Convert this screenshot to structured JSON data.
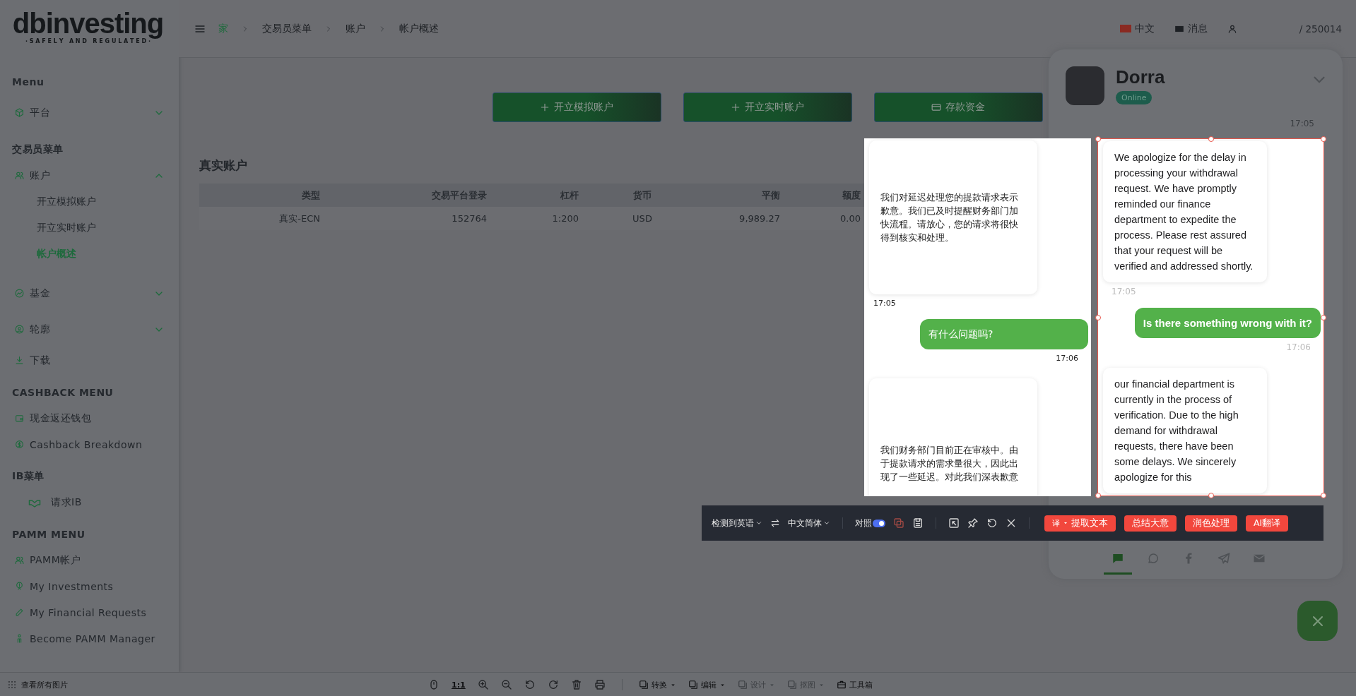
{
  "page": {
    "logo": {
      "name": "dbinvesting",
      "tagline": "· S A F E L Y   A N D   R E G U L A T E D ·"
    },
    "sidebar": {
      "sections": [
        {
          "heading": "Menu",
          "items": [
            {
              "label": "平台",
              "expanded": false
            }
          ]
        },
        {
          "heading": "交易员菜单",
          "items": [
            {
              "label": "账户",
              "expanded": true,
              "children": [
                {
                  "label": "开立模拟账户",
                  "selected": false
                },
                {
                  "label": "开立实时账户",
                  "selected": false
                },
                {
                  "label": "帐户概述",
                  "selected": true
                }
              ]
            },
            {
              "label": "基金",
              "expanded": false
            },
            {
              "label": "轮廓",
              "expanded": false
            },
            {
              "label": "下载"
            }
          ]
        },
        {
          "heading": "CASHBACK MENU",
          "items": [
            {
              "label": "现金返还钱包"
            },
            {
              "label": "Cashback Breakdown"
            }
          ]
        },
        {
          "heading": "IB菜单",
          "items": [
            {
              "label": "请求IB"
            }
          ]
        },
        {
          "heading": "PAMM MENU",
          "items": [
            {
              "label": "PAMM帐户"
            },
            {
              "label": "My Investments"
            },
            {
              "label": "My Financial Requests"
            },
            {
              "label": "Become PAMM Manager"
            }
          ]
        }
      ]
    },
    "breadcrumbs": [
      "家",
      "交易员菜单",
      "账户",
      "帐户概述"
    ],
    "topbar_right": {
      "language": "中文",
      "messages": "消息",
      "account": "/ 250014"
    },
    "buttons": [
      "开立模拟账户",
      "开立实时账户",
      "存款资金"
    ],
    "section_title": "真实账户",
    "table": {
      "columns": [
        "类型",
        "交易平台登录",
        "杠杆",
        "货币",
        "平衡",
        "额度"
      ],
      "rows": [
        [
          "真实-ECN",
          "152764",
          "1:200",
          "USD",
          "9,989.27",
          "0.00"
        ]
      ]
    }
  },
  "chat": {
    "agent": "Dorra",
    "status": "Online",
    "top_time": "17:05",
    "tabs": [
      {
        "selected": true
      },
      {
        "selected": false
      },
      {
        "selected": false
      },
      {
        "selected": false
      },
      {
        "selected": false
      }
    ]
  },
  "translation": {
    "translated": [
      {
        "kind": "incoming",
        "text": "我们对延迟处理您的提款请求表示歉意。我们已及时提醒财务部门加快流程。请放心，您的请求将很快得到核实和处理。",
        "time": "17:05"
      },
      {
        "kind": "outgoing",
        "text": "有什么问题吗?",
        "time": "17:06"
      },
      {
        "kind": "incoming",
        "text": "我们财务部门目前正在审核中。由于提款请求的需求量很大，因此出现了一些延迟。对此我们深表歉意"
      }
    ],
    "original": [
      {
        "kind": "incoming",
        "text": "We apologize for the delay in processing your withdrawal request. We have promptly reminded our finance department to expedite the process. Please rest assured that your request will be verified and addressed shortly.",
        "time": "17:05"
      },
      {
        "kind": "outgoing",
        "text": "Is there something wrong with it?",
        "time": "17:06"
      },
      {
        "kind": "incoming",
        "text": "our financial department is currently in the process of verification. Due to the high demand for withdrawal requests, there have been some delays. We sincerely apologize for this"
      }
    ]
  },
  "toolbar": {
    "source_lang": "检测到英语",
    "target_lang": "中文简体",
    "compare": {
      "label": "对照",
      "on": true
    },
    "actions": [
      {
        "icon_text": "译",
        "label": "提取文本"
      },
      {
        "label": "总结大意"
      },
      {
        "label": "润色处理"
      },
      {
        "label": "AI翻译"
      }
    ]
  },
  "viewer_bar": {
    "view_all": "查看所有图片",
    "zoom_reset": "1:1",
    "menus": [
      {
        "label": "转换",
        "disabled": false
      },
      {
        "label": "编辑",
        "disabled": false
      },
      {
        "label": "设计",
        "disabled": true
      },
      {
        "label": "抠图",
        "disabled": true
      }
    ],
    "toolbox": "工具箱"
  }
}
